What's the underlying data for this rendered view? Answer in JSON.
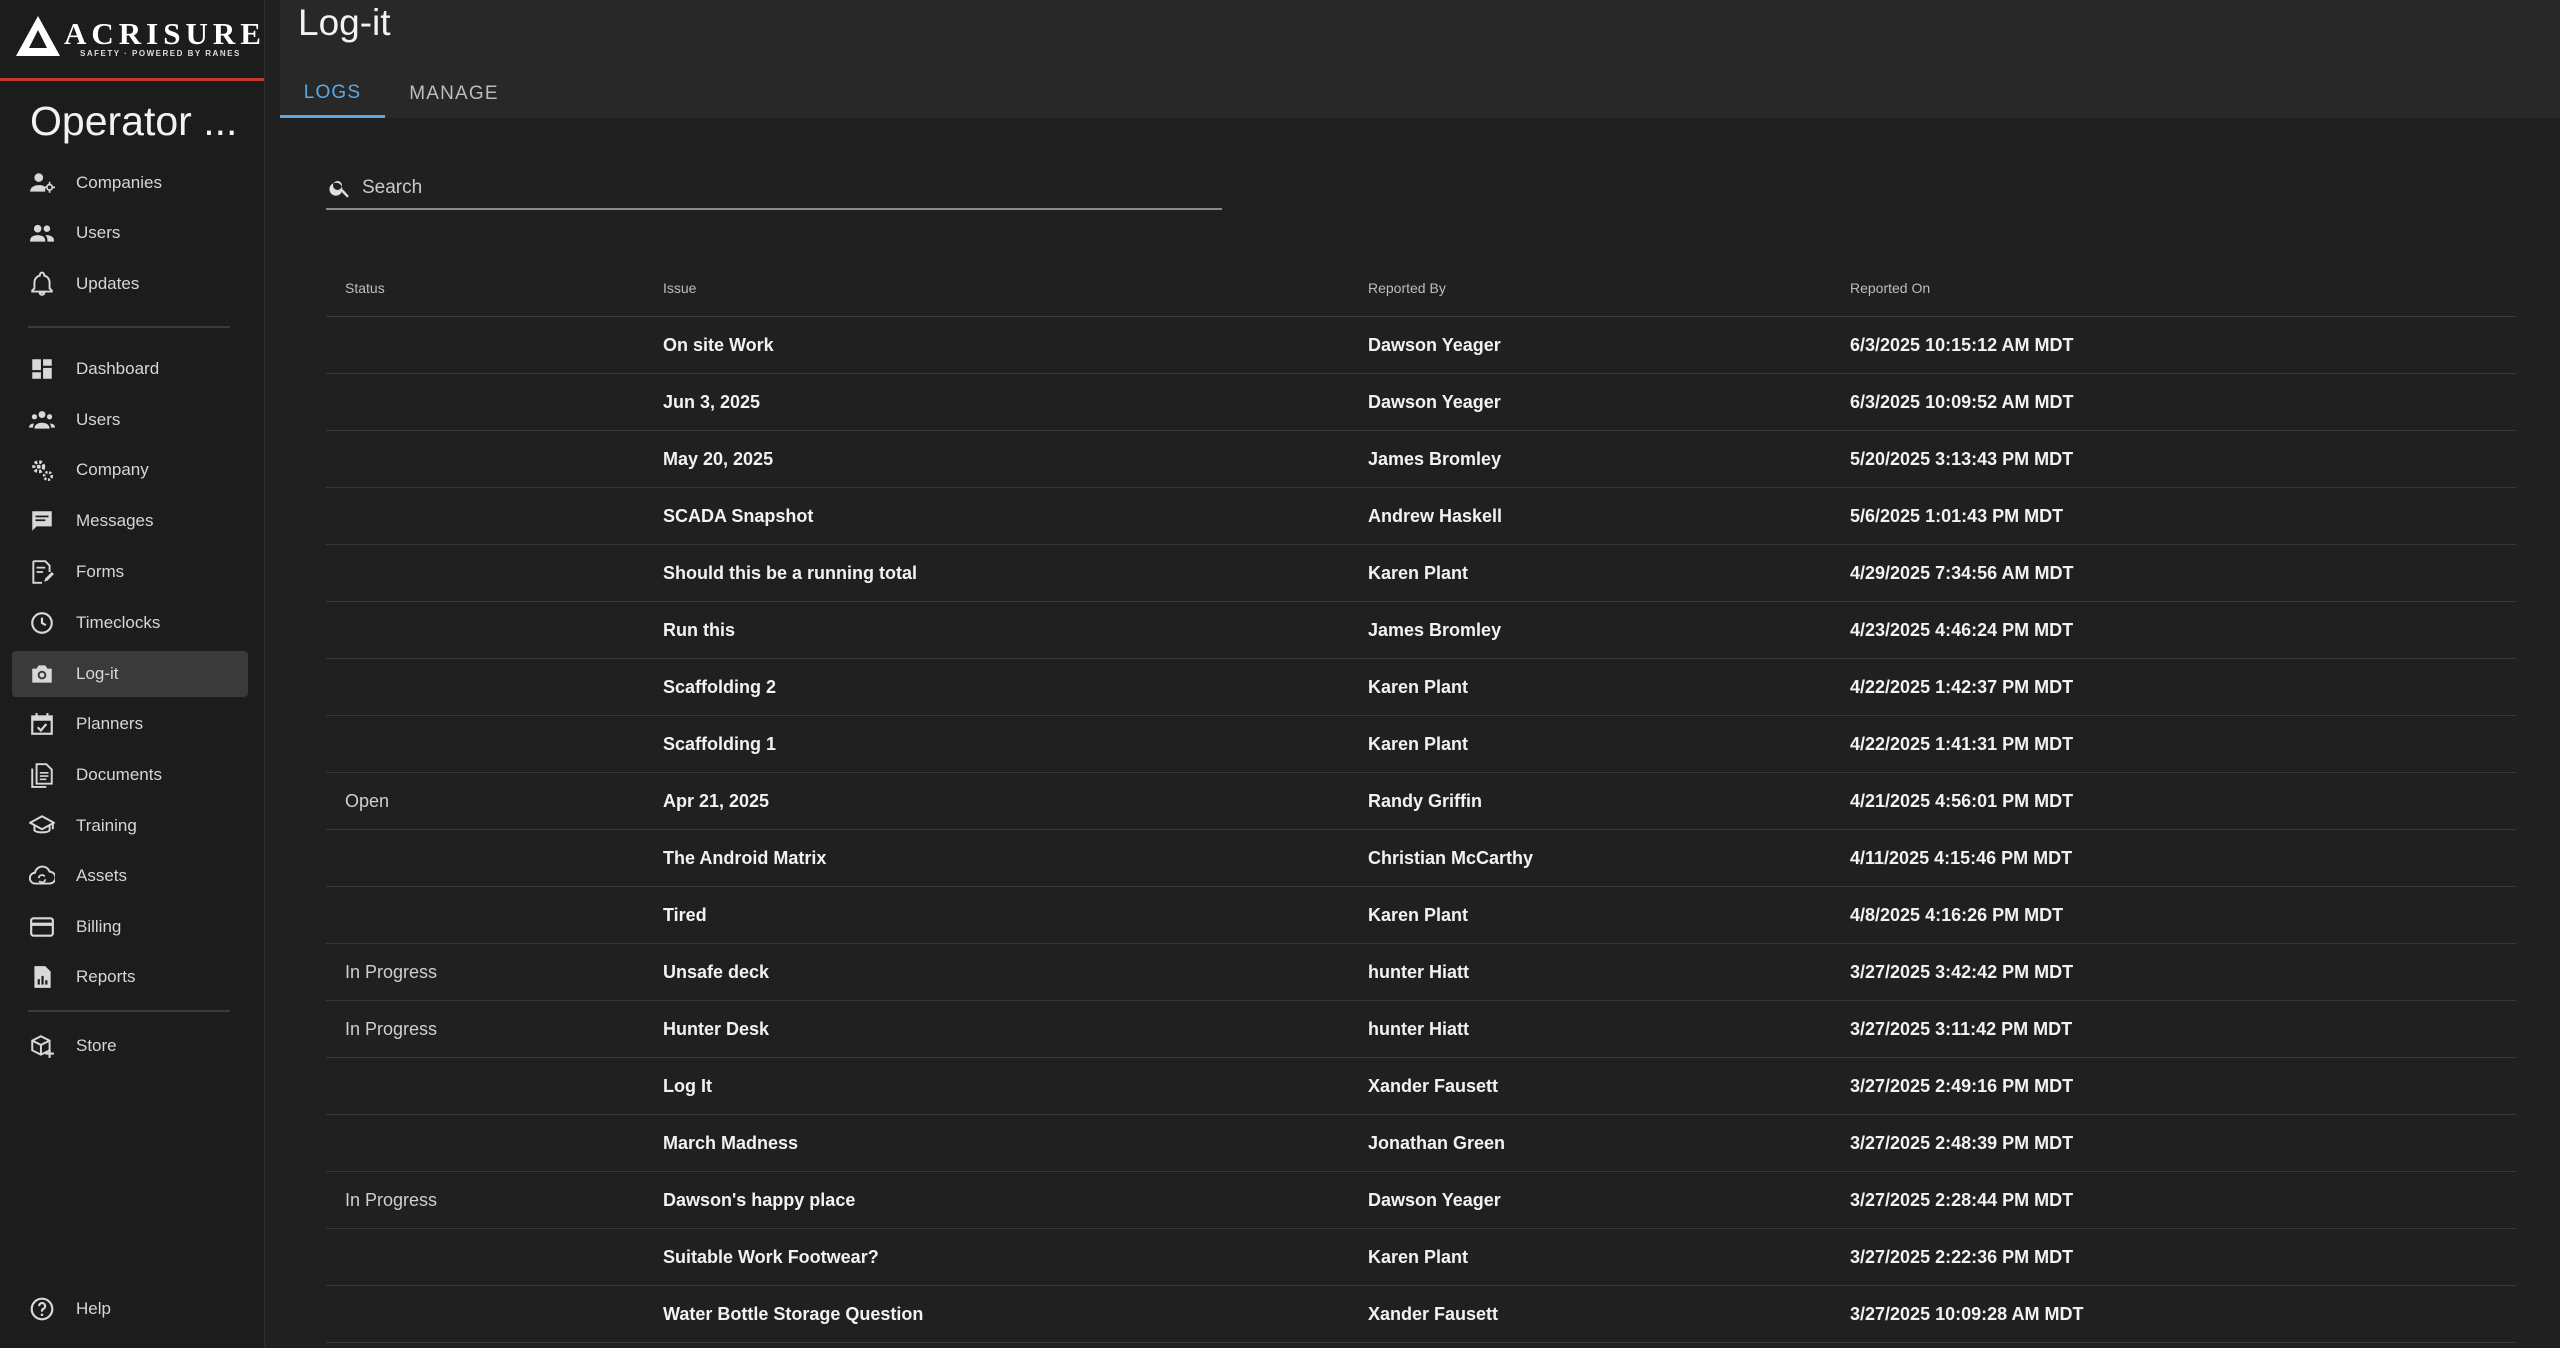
{
  "brand": {
    "name": "ACRISURE",
    "tagline": "SAFETY · POWERED BY RANES"
  },
  "sidebar": {
    "title": "Operator ...",
    "group1": [
      {
        "label": "Companies",
        "icon": "company-users-icon"
      },
      {
        "label": "Users",
        "icon": "users-icon"
      },
      {
        "label": "Updates",
        "icon": "bell-icon"
      }
    ],
    "group2": [
      {
        "label": "Dashboard",
        "icon": "dashboard-icon"
      },
      {
        "label": "Users",
        "icon": "users-icon"
      },
      {
        "label": "Company",
        "icon": "gears-icon"
      },
      {
        "label": "Messages",
        "icon": "message-icon"
      },
      {
        "label": "Forms",
        "icon": "form-edit-icon"
      },
      {
        "label": "Timeclocks",
        "icon": "clock-icon"
      },
      {
        "label": "Log-it",
        "icon": "camera-icon"
      },
      {
        "label": "Planners",
        "icon": "calendar-check-icon"
      },
      {
        "label": "Documents",
        "icon": "documents-icon"
      },
      {
        "label": "Training",
        "icon": "school-icon"
      },
      {
        "label": "Assets",
        "icon": "cloud-sync-icon"
      },
      {
        "label": "Billing",
        "icon": "credit-card-icon"
      },
      {
        "label": "Reports",
        "icon": "report-icon"
      }
    ],
    "store": {
      "label": "Store",
      "icon": "store-icon"
    },
    "help": {
      "label": "Help",
      "icon": "help-icon"
    },
    "active": "Log-it"
  },
  "header": {
    "title": "Log-it",
    "tabs": [
      {
        "label": "LOGS",
        "active": true
      },
      {
        "label": "MANAGE",
        "active": false
      }
    ]
  },
  "search": {
    "placeholder": "Search",
    "value": ""
  },
  "table": {
    "columns": [
      "Status",
      "Issue",
      "Reported By",
      "Reported On"
    ],
    "rows": [
      {
        "status": "",
        "issue": "On site Work",
        "reported_by": "Dawson Yeager",
        "reported_on": "6/3/2025 10:15:12 AM MDT"
      },
      {
        "status": "",
        "issue": "Jun 3, 2025",
        "reported_by": "Dawson Yeager",
        "reported_on": "6/3/2025 10:09:52 AM MDT"
      },
      {
        "status": "",
        "issue": "May 20, 2025",
        "reported_by": "James Bromley",
        "reported_on": "5/20/2025 3:13:43 PM MDT"
      },
      {
        "status": "",
        "issue": "SCADA Snapshot",
        "reported_by": "Andrew Haskell",
        "reported_on": "5/6/2025 1:01:43 PM MDT"
      },
      {
        "status": "",
        "issue": "Should this be a running total",
        "reported_by": "Karen Plant",
        "reported_on": "4/29/2025 7:34:56 AM MDT"
      },
      {
        "status": "",
        "issue": "Run this",
        "reported_by": "James Bromley",
        "reported_on": "4/23/2025 4:46:24 PM MDT"
      },
      {
        "status": "",
        "issue": "Scaffolding 2",
        "reported_by": "Karen Plant",
        "reported_on": "4/22/2025 1:42:37 PM MDT"
      },
      {
        "status": "",
        "issue": "Scaffolding 1",
        "reported_by": "Karen Plant",
        "reported_on": "4/22/2025 1:41:31 PM MDT"
      },
      {
        "status": "Open",
        "issue": "Apr 21, 2025",
        "reported_by": "Randy Griffin",
        "reported_on": "4/21/2025 4:56:01 PM MDT"
      },
      {
        "status": "",
        "issue": "The Android Matrix",
        "reported_by": "Christian McCarthy",
        "reported_on": "4/11/2025 4:15:46 PM MDT"
      },
      {
        "status": "",
        "issue": "Tired",
        "reported_by": "Karen Plant",
        "reported_on": "4/8/2025 4:16:26 PM MDT"
      },
      {
        "status": "In Progress",
        "issue": "Unsafe deck",
        "reported_by": "hunter Hiatt",
        "reported_on": "3/27/2025 3:42:42 PM MDT"
      },
      {
        "status": "In Progress",
        "issue": "Hunter Desk",
        "reported_by": "hunter Hiatt",
        "reported_on": "3/27/2025 3:11:42 PM MDT"
      },
      {
        "status": "",
        "issue": "Log It",
        "reported_by": "Xander Fausett",
        "reported_on": "3/27/2025 2:49:16 PM MDT"
      },
      {
        "status": "",
        "issue": "March Madness",
        "reported_by": "Jonathan Green",
        "reported_on": "3/27/2025 2:48:39 PM MDT"
      },
      {
        "status": "In Progress",
        "issue": "Dawson's happy place",
        "reported_by": "Dawson Yeager",
        "reported_on": "3/27/2025 2:28:44 PM MDT"
      },
      {
        "status": "",
        "issue": "Suitable Work Footwear?",
        "reported_by": "Karen Plant",
        "reported_on": "3/27/2025 2:22:36 PM MDT"
      },
      {
        "status": "",
        "issue": "Water Bottle Storage Question",
        "reported_by": "Xander Fausett",
        "reported_on": "3/27/2025 10:09:28 AM MDT"
      }
    ]
  },
  "colors": {
    "accent": "#5aa9e6",
    "brand_red": "#c0392b",
    "sidebar_bg": "#1b1b1b",
    "main_bg": "#202020"
  }
}
